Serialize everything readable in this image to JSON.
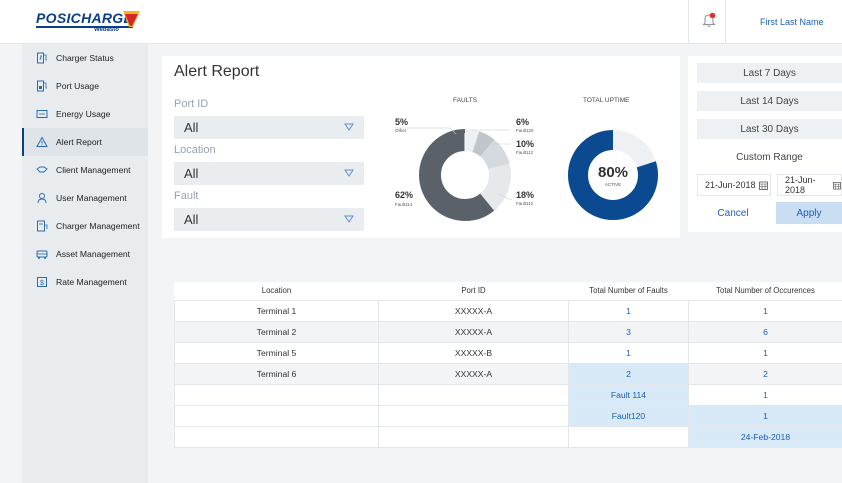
{
  "brand": {
    "name": "POSICHARGE",
    "sub": "Webasto",
    "color": "#0b3f84"
  },
  "header": {
    "user_name": "First Last Name",
    "bell_icon": "bell-alert-icon"
  },
  "sidebar": {
    "items": [
      {
        "label": "Charger Status",
        "icon": "charger-icon"
      },
      {
        "label": "Port Usage",
        "icon": "port-icon"
      },
      {
        "label": "Energy Usage",
        "icon": "energy-icon"
      },
      {
        "label": "Alert Report",
        "icon": "warning-icon",
        "active": true
      },
      {
        "label": "Client Management",
        "icon": "client-icon"
      },
      {
        "label": "User Management",
        "icon": "user-icon"
      },
      {
        "label": "Charger Management",
        "icon": "charger-management-icon"
      },
      {
        "label": "Asset Management",
        "icon": "asset-icon"
      },
      {
        "label": "Rate Management",
        "icon": "rate-icon"
      }
    ]
  },
  "page": {
    "title": "Alert Report"
  },
  "filters": {
    "port_id": {
      "label": "Port ID",
      "value": "All"
    },
    "location": {
      "label": "Location",
      "value": "All"
    },
    "fault": {
      "label": "Fault",
      "value": "All"
    }
  },
  "faults_chart": {
    "title": "FAULTS",
    "slices": [
      {
        "pct": "5%",
        "name": "Other",
        "color": "#eef1f4"
      },
      {
        "pct": "6%",
        "name": "Fault120",
        "color": "#bfc5cb"
      },
      {
        "pct": "10%",
        "name": "Fault112",
        "color": "#d5dadf"
      },
      {
        "pct": "18%",
        "name": "Fault112",
        "color": "#e6e9ec"
      },
      {
        "pct": "62%",
        "name": "Fault114",
        "color": "#5a6169"
      }
    ]
  },
  "uptime_chart": {
    "title": "TOTAL UPTIME",
    "value": "80%",
    "label": "ACTIVE",
    "color": "#0b4a91",
    "track_color": "#eef1f4"
  },
  "date_range": {
    "options": [
      "Last 7 Days",
      "Last 14 Days",
      "Last 30 Days"
    ],
    "custom": "Custom Range",
    "start": "21-Jun-2018",
    "end": "21-Jun-2018",
    "cancel": "Cancel",
    "apply": "Apply"
  },
  "table": {
    "headers": [
      "Location",
      "Port ID",
      "Total Number of Faults",
      "Total Number of Occurences"
    ],
    "rows": [
      [
        "Terminal 1",
        "XXXXX-A",
        "1",
        "1"
      ],
      [
        "Terminal 2",
        "XXXXX-A",
        "3",
        "6"
      ],
      [
        "Terminal 5",
        "XXXXX-B",
        "1",
        "1"
      ],
      [
        "Terminal 6",
        "XXXXX-A",
        "2",
        "2"
      ],
      [
        "",
        "",
        "Fault 114",
        "1"
      ],
      [
        "",
        "",
        "Fault120",
        "1"
      ],
      [
        "",
        "",
        "",
        "24-Feb-2018"
      ]
    ]
  }
}
